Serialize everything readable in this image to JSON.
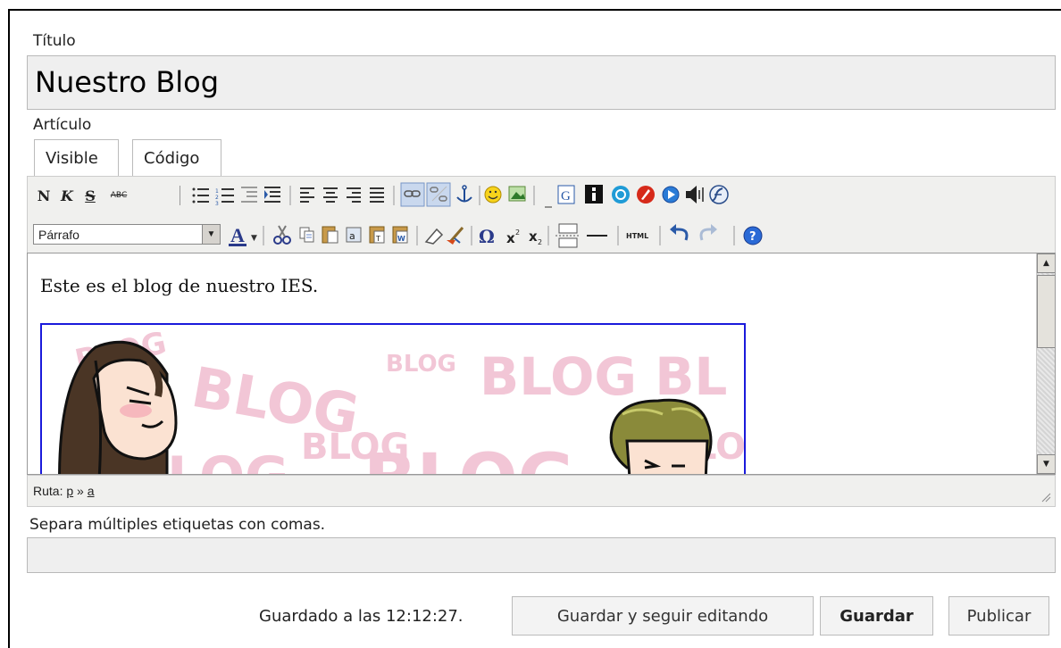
{
  "form": {
    "title_label": "Título",
    "title_value": "Nuestro Blog",
    "article_label": "Artículo",
    "tags_hint": "Separa múltiples etiquetas con comas.",
    "tags_value": ""
  },
  "tabs": [
    {
      "label": "Visible",
      "active": true
    },
    {
      "label": "Código",
      "active": false
    }
  ],
  "toolbar": {
    "bold": "N",
    "italic": "K",
    "strike": "S",
    "spell": "ABC",
    "omega": "Ω",
    "sup": "x²",
    "sub": "x₂",
    "html": "HTML",
    "format_select": "Párrafo"
  },
  "editor": {
    "content_text": "Este es el blog de nuestro IES.",
    "image_words": [
      "BLOG",
      "BLOG",
      "BLOG",
      "BLOG BL",
      "LOG",
      "BLOG",
      "BLOG",
      "LOG"
    ]
  },
  "status": {
    "path_label": "Ruta:",
    "path_p": "p",
    "path_sep": "»",
    "path_a": "a"
  },
  "footer": {
    "saved_text": "Guardado a las 12:12:27.",
    "save_continue": "Guardar y seguir editando",
    "save": "Guardar",
    "publish": "Publicar"
  },
  "colors": {
    "image_border": "#1a1adb",
    "image_text": "#f2c6d6"
  }
}
